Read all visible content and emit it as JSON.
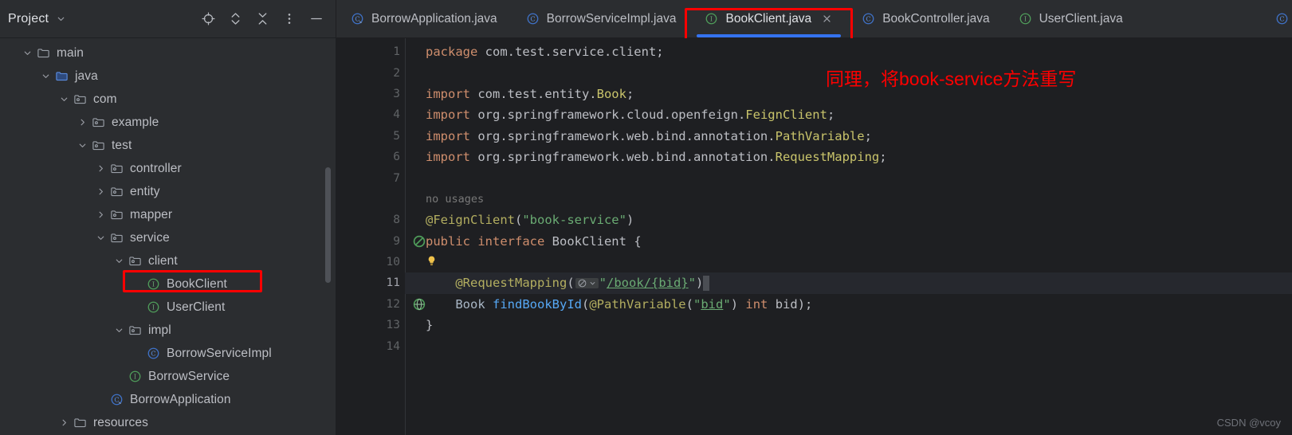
{
  "sidebar": {
    "title": "Project",
    "title_chevron_icon": "chevron-down-icon",
    "tools": [
      {
        "name": "locate-target-icon",
        "label": "Select Opened File"
      },
      {
        "name": "expand-all-icon",
        "label": "Expand All"
      },
      {
        "name": "collapse-all-icon",
        "label": "Collapse All"
      },
      {
        "name": "more-options-icon",
        "label": "Options"
      },
      {
        "name": "hide-panel-icon",
        "label": "Hide"
      }
    ],
    "tree": [
      {
        "label": "main",
        "indent": 2,
        "arrow": "down",
        "icon": "folder-icon",
        "selected": false
      },
      {
        "label": "java",
        "indent": 3,
        "arrow": "down",
        "icon": "source-root-folder-icon",
        "selected": false
      },
      {
        "label": "com",
        "indent": 4,
        "arrow": "down",
        "icon": "package-icon",
        "selected": false
      },
      {
        "label": "example",
        "indent": 5,
        "arrow": "right",
        "icon": "package-icon",
        "selected": false
      },
      {
        "label": "test",
        "indent": 5,
        "arrow": "down",
        "icon": "package-icon",
        "selected": false
      },
      {
        "label": "controller",
        "indent": 6,
        "arrow": "right",
        "icon": "package-icon",
        "selected": false
      },
      {
        "label": "entity",
        "indent": 6,
        "arrow": "right",
        "icon": "package-icon",
        "selected": false
      },
      {
        "label": "mapper",
        "indent": 6,
        "arrow": "right",
        "icon": "package-icon",
        "selected": false
      },
      {
        "label": "service",
        "indent": 6,
        "arrow": "down",
        "icon": "package-icon",
        "selected": false
      },
      {
        "label": "client",
        "indent": 7,
        "arrow": "down",
        "icon": "package-icon",
        "selected": false
      },
      {
        "label": "BookClient",
        "indent": 8,
        "arrow": "none",
        "icon": "interface-icon",
        "selected": true
      },
      {
        "label": "UserClient",
        "indent": 8,
        "arrow": "none",
        "icon": "interface-icon",
        "selected": false
      },
      {
        "label": "impl",
        "indent": 7,
        "arrow": "down",
        "icon": "package-icon",
        "selected": false
      },
      {
        "label": "BorrowServiceImpl",
        "indent": 8,
        "arrow": "none",
        "icon": "class-icon",
        "selected": false
      },
      {
        "label": "BorrowService",
        "indent": 7,
        "arrow": "none",
        "icon": "interface-icon",
        "selected": false
      },
      {
        "label": "BorrowApplication",
        "indent": 6,
        "arrow": "none",
        "icon": "spring-class-icon",
        "selected": false
      },
      {
        "label": "resources",
        "indent": 4,
        "arrow": "right",
        "icon": "folder-icon",
        "selected": false
      }
    ]
  },
  "tabs": [
    {
      "label": "BorrowApplication.java",
      "icon": "spring-class-icon",
      "active": false,
      "closable": false
    },
    {
      "label": "BorrowServiceImpl.java",
      "icon": "class-icon",
      "active": false,
      "closable": false
    },
    {
      "label": "BookClient.java",
      "icon": "interface-icon",
      "active": true,
      "closable": true,
      "close_icon": "close-icon"
    },
    {
      "label": "BookController.java",
      "icon": "class-icon",
      "active": false,
      "closable": false
    },
    {
      "label": "UserClient.java",
      "icon": "interface-icon",
      "active": false,
      "closable": false
    }
  ],
  "tabbar_trailing_icon": "class-icon",
  "editor": {
    "lines": [
      {
        "num": "1",
        "gutter_icon": null,
        "current": false,
        "hint": null,
        "tokens": [
          {
            "t": "package ",
            "c": "kw"
          },
          {
            "t": "com.test.service.client;",
            "c": "id"
          }
        ]
      },
      {
        "num": "2",
        "gutter_icon": null,
        "current": false,
        "hint": null,
        "tokens": []
      },
      {
        "num": "3",
        "gutter_icon": null,
        "current": false,
        "hint": null,
        "tokens": [
          {
            "t": "import ",
            "c": "kw"
          },
          {
            "t": "com.test.entity.",
            "c": "id"
          },
          {
            "t": "Book",
            "c": "cls"
          },
          {
            "t": ";",
            "c": "id"
          }
        ]
      },
      {
        "num": "4",
        "gutter_icon": null,
        "current": false,
        "hint": null,
        "tokens": [
          {
            "t": "import ",
            "c": "kw"
          },
          {
            "t": "org.springframework.cloud.openfeign.",
            "c": "id"
          },
          {
            "t": "FeignClient",
            "c": "cls"
          },
          {
            "t": ";",
            "c": "id"
          }
        ]
      },
      {
        "num": "5",
        "gutter_icon": null,
        "current": false,
        "hint": null,
        "tokens": [
          {
            "t": "import ",
            "c": "kw"
          },
          {
            "t": "org.springframework.web.bind.annotation.",
            "c": "id"
          },
          {
            "t": "PathVariable",
            "c": "cls"
          },
          {
            "t": ";",
            "c": "id"
          }
        ]
      },
      {
        "num": "6",
        "gutter_icon": null,
        "current": false,
        "hint": null,
        "tokens": [
          {
            "t": "import ",
            "c": "kw"
          },
          {
            "t": "org.springframework.web.bind.annotation.",
            "c": "id"
          },
          {
            "t": "RequestMapping",
            "c": "cls"
          },
          {
            "t": ";",
            "c": "id"
          }
        ]
      },
      {
        "num": "7",
        "gutter_icon": null,
        "current": false,
        "hint": null,
        "tokens": []
      },
      {
        "num": "",
        "gutter_icon": null,
        "current": false,
        "hint": "no usages",
        "tokens": []
      },
      {
        "num": "8",
        "gutter_icon": null,
        "current": false,
        "hint": null,
        "tokens": [
          {
            "t": "@FeignClient",
            "c": "anno"
          },
          {
            "t": "(",
            "c": "punc"
          },
          {
            "t": "\"book-service\"",
            "c": "str"
          },
          {
            "t": ")",
            "c": "punc"
          }
        ]
      },
      {
        "num": "9",
        "gutter_icon": "implemented-icon",
        "current": false,
        "hint": null,
        "tokens": [
          {
            "t": "public ",
            "c": "kw"
          },
          {
            "t": "interface ",
            "c": "kw"
          },
          {
            "t": "BookClient",
            "c": "id"
          },
          {
            "t": " {",
            "c": "punc"
          }
        ]
      },
      {
        "num": "10",
        "gutter_icon": null,
        "current": false,
        "hint": null,
        "tokens": [],
        "bulb": true
      },
      {
        "num": "11",
        "gutter_icon": null,
        "current": true,
        "hint": null,
        "tokens": [
          {
            "t": "    ",
            "c": "id"
          },
          {
            "t": "@RequestMapping",
            "c": "anno"
          },
          {
            "t": "(",
            "c": "punc"
          }
        ],
        "widget": true,
        "after_widget": [
          {
            "t": "\"",
            "c": "str"
          },
          {
            "t": "/book/{bid}",
            "c": "ulink"
          },
          {
            "t": "\"",
            "c": "str"
          },
          {
            "t": ")",
            "c": "punc"
          }
        ]
      },
      {
        "num": "12",
        "gutter_icon": "web-endpoint-icon",
        "current": false,
        "hint": null,
        "tokens": [
          {
            "t": "    ",
            "c": "id"
          },
          {
            "t": "Book ",
            "c": "type"
          },
          {
            "t": "findBookById",
            "c": "mth"
          },
          {
            "t": "(",
            "c": "punc"
          },
          {
            "t": "@PathVariable",
            "c": "anno"
          },
          {
            "t": "(",
            "c": "punc"
          },
          {
            "t": "\"",
            "c": "str"
          },
          {
            "t": "bid",
            "c": "ulink2"
          },
          {
            "t": "\"",
            "c": "str"
          },
          {
            "t": ") ",
            "c": "punc"
          },
          {
            "t": "int ",
            "c": "kw"
          },
          {
            "t": "bid",
            "c": "id"
          },
          {
            "t": ");",
            "c": "punc"
          }
        ]
      },
      {
        "num": "13",
        "gutter_icon": null,
        "current": false,
        "hint": null,
        "tokens": [
          {
            "t": "}",
            "c": "punc"
          }
        ]
      },
      {
        "num": "14",
        "gutter_icon": null,
        "current": false,
        "hint": null,
        "tokens": []
      }
    ]
  },
  "annotation": {
    "note_text": "同理，将book-service方法重写",
    "note_color": "#fe0000"
  },
  "watermark": "CSDN @vcoy",
  "colors": {
    "accent_blue": "#3573f0",
    "highlight_red": "#fe0000",
    "bg_editor": "#1e1f22",
    "bg_panel": "#2b2d30"
  }
}
